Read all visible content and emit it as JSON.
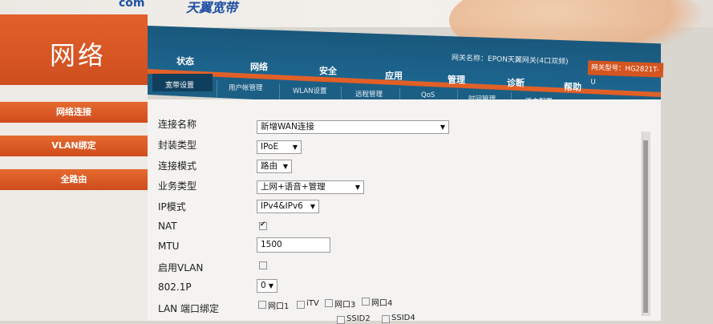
{
  "header": {
    "brand_left": "com",
    "brand_name": "天翼宽带",
    "page_title": "网络",
    "gateway_name_label": "网关名称：EPON天翼网关(4口双频)",
    "gateway_model_label": "网关型号：HG2821T-U"
  },
  "main_nav": [
    "状态",
    "网络",
    "安全",
    "应用",
    "管理",
    "诊断",
    "帮助"
  ],
  "sub_nav": [
    "宽带设置",
    "用户帐管理",
    "WLAN设置",
    "远程管理",
    "QoS",
    "时间管理",
    "路由配置"
  ],
  "sidebar": [
    "网络连接",
    "VLAN绑定",
    "全路由"
  ],
  "form": {
    "conn_name_label": "连接名称",
    "conn_name_value": "新增WAN连接",
    "encap_label": "封装类型",
    "encap_value": "IPoE",
    "conn_mode_label": "连接模式",
    "conn_mode_value": "路由",
    "service_label": "业务类型",
    "service_value": "上网+语音+管理",
    "ip_mode_label": "IP模式",
    "ip_mode_value": "IPv4&IPv6",
    "nat_label": "NAT",
    "nat_checked": true,
    "mtu_label": "MTU",
    "mtu_value": "1500",
    "vlan_label": "启用VLAN",
    "vlan_checked": false,
    "p8021_label": "802.1P",
    "p8021_value": "0",
    "lan_bind_label": "LAN 端口绑定",
    "lan_ports": [
      "网口1",
      "iTV",
      "网口3",
      "网口4"
    ],
    "lan_ports_row2": [
      "SSID2",
      "SSID4"
    ]
  },
  "colors": {
    "orange": "#e0602a",
    "navy": "#1b5e86"
  }
}
